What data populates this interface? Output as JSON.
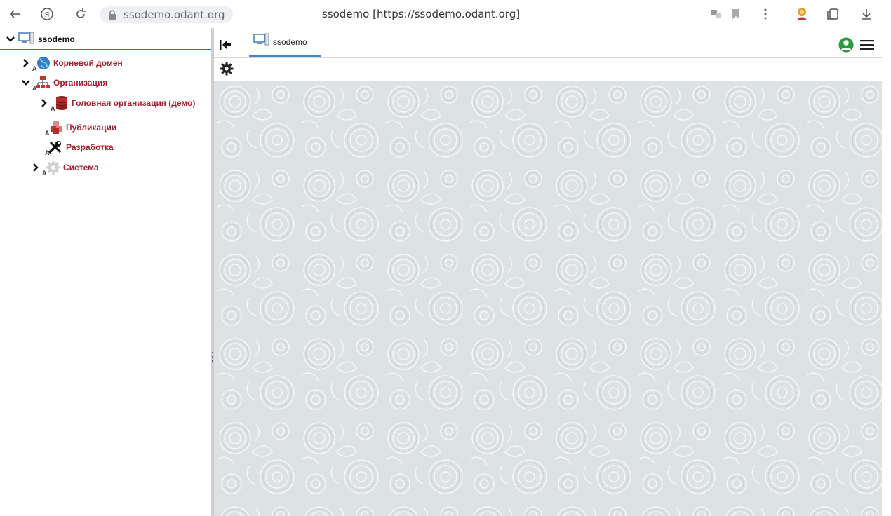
{
  "browser": {
    "address_url": "ssodemo.odant.org",
    "page_title": "ssodemo [https://ssodemo.odant.org]"
  },
  "tree": {
    "root": {
      "label": "ssodemo"
    },
    "items": [
      {
        "label": "Корневой домен"
      },
      {
        "label": "Организация"
      },
      {
        "label": "Головная организация (демо)"
      },
      {
        "label": "Публикации"
      },
      {
        "label": "Разработка"
      },
      {
        "label": "Система"
      }
    ]
  },
  "main": {
    "tab_label": "ssodemo"
  },
  "colors": {
    "accent": "#3f86c9",
    "tree_label": "#a31f2b",
    "user_icon": "#2e9a3e"
  }
}
